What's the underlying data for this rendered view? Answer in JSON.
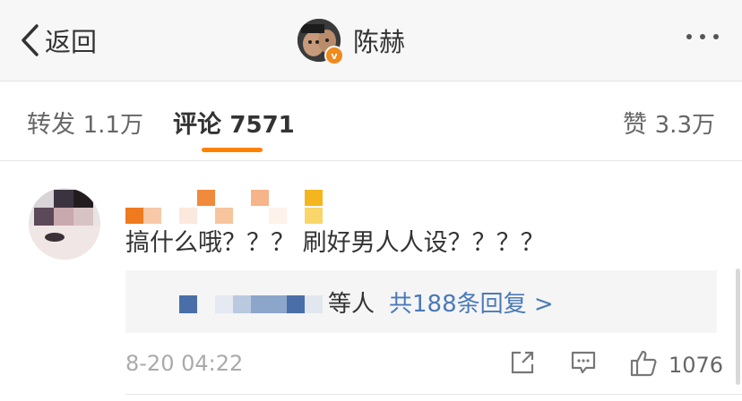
{
  "nav": {
    "back_label": "返回",
    "title": "陈赫",
    "verified_badge": "v"
  },
  "tabs": {
    "repost_label": "转发",
    "repost_count": "1.1万",
    "comment_label": "评论",
    "comment_count": "7571",
    "like_label": "赞",
    "like_count": "3.3万"
  },
  "comment": {
    "text": "搞什么哦？？？ 刷好男人人设？？？？",
    "reply_suffix": "等人",
    "reply_link": "共188条回复 >",
    "time": "8-20 04:22",
    "like_count": "1076"
  },
  "colors": {
    "accent": "#ff8200",
    "link": "#4a7ab8",
    "muted": "#aaaaaa"
  },
  "icons": {
    "back": "chevron-left-icon",
    "more": "ellipsis-icon",
    "share": "share-icon",
    "reply": "comment-icon",
    "like": "thumbs-up-icon"
  }
}
